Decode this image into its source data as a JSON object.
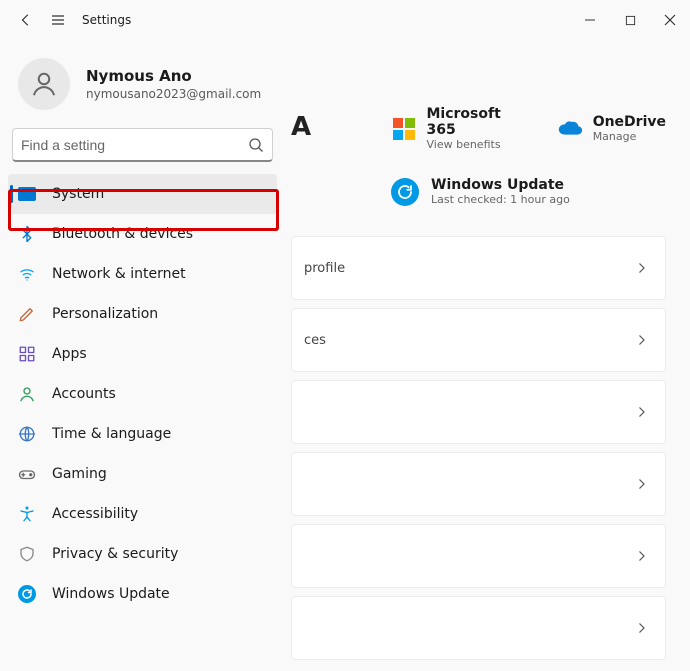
{
  "titlebar": {
    "title": "Settings"
  },
  "profile": {
    "name": "Nymous Ano",
    "email": "nymousano2023@gmail.com"
  },
  "search": {
    "placeholder": "Find a setting"
  },
  "nav": [
    {
      "key": "system",
      "label": "System",
      "selected": true,
      "iconColor": "#0078d4"
    },
    {
      "key": "bluetooth",
      "label": "Bluetooth & devices",
      "selected": false,
      "iconColor": "#0078d4"
    },
    {
      "key": "network",
      "label": "Network & internet",
      "selected": false,
      "iconColor": "#00a2ed"
    },
    {
      "key": "personalize",
      "label": "Personalization",
      "selected": false,
      "iconColor": "#c06a3e"
    },
    {
      "key": "apps",
      "label": "Apps",
      "selected": false,
      "iconColor": "#6b4fbb"
    },
    {
      "key": "accounts",
      "label": "Accounts",
      "selected": false,
      "iconColor": "#2e9e5b"
    },
    {
      "key": "time",
      "label": "Time & language",
      "selected": false,
      "iconColor": "#3a77c3"
    },
    {
      "key": "gaming",
      "label": "Gaming",
      "selected": false,
      "iconColor": "#6a6a6a"
    },
    {
      "key": "accessibility",
      "label": "Accessibility",
      "selected": false,
      "iconColor": "#0099e5"
    },
    {
      "key": "privacy",
      "label": "Privacy & security",
      "selected": false,
      "iconColor": "#8a8a8a"
    },
    {
      "key": "update",
      "label": "Windows Update",
      "selected": false,
      "iconColor": "#0099e5"
    }
  ],
  "main": {
    "heading_fragment": "A",
    "m365": {
      "title": "Microsoft 365",
      "sub": "View benefits"
    },
    "onedrive": {
      "title": "OneDrive",
      "sub": "Manage"
    },
    "winupdate": {
      "title": "Windows Update",
      "sub": "Last checked: 1 hour ago"
    },
    "cards": [
      {
        "label": "profile"
      },
      {
        "label": "ces"
      },
      {
        "label": ""
      },
      {
        "label": ""
      },
      {
        "label": ""
      },
      {
        "label": ""
      }
    ]
  },
  "highlight": {
    "target": "system"
  }
}
